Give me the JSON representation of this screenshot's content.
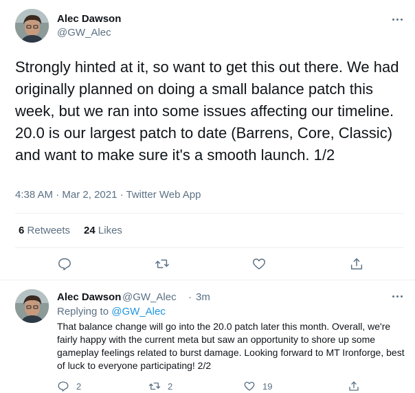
{
  "tweet": {
    "author_name": "Alec Dawson",
    "author_handle": "@GW_Alec",
    "text": "Strongly hinted at it, so want to get this out there. We had originally planned on doing a small balance patch this week, but we ran into some issues affecting our timeline. 20.0 is our largest patch to date (Barrens, Core, Classic) and want to make sure it's a smooth launch. 1/2",
    "time": "4:38 AM",
    "separator": "·",
    "date": "Mar 2, 2021",
    "source": "Twitter Web App",
    "retweets_count": "6",
    "retweets_label": "Retweets",
    "likes_count": "24",
    "likes_label": "Likes"
  },
  "reply": {
    "author_name": "Alec Dawson",
    "author_handle": "@GW_Alec",
    "dot": "·",
    "time": "3m",
    "replying_prefix": "Replying to",
    "replying_to": "@GW_Alec",
    "text": "That balance change will go into the 20.0 patch later this month. Overall, we're fairly happy with the current meta but saw an opportunity to shore up some gameplay feelings related to burst damage. Looking forward to MT Ironforge, best of luck to everyone participating! 2/2",
    "reply_count": "2",
    "retweet_count": "2",
    "like_count": "19"
  },
  "icons": {
    "more": "more-icon",
    "reply": "reply-icon",
    "retweet": "retweet-icon",
    "like": "heart-icon",
    "share": "share-icon"
  },
  "colors": {
    "text": "#0f1419",
    "secondary": "#5b7083",
    "link": "#1b95e0",
    "divider": "#ebeef0"
  }
}
